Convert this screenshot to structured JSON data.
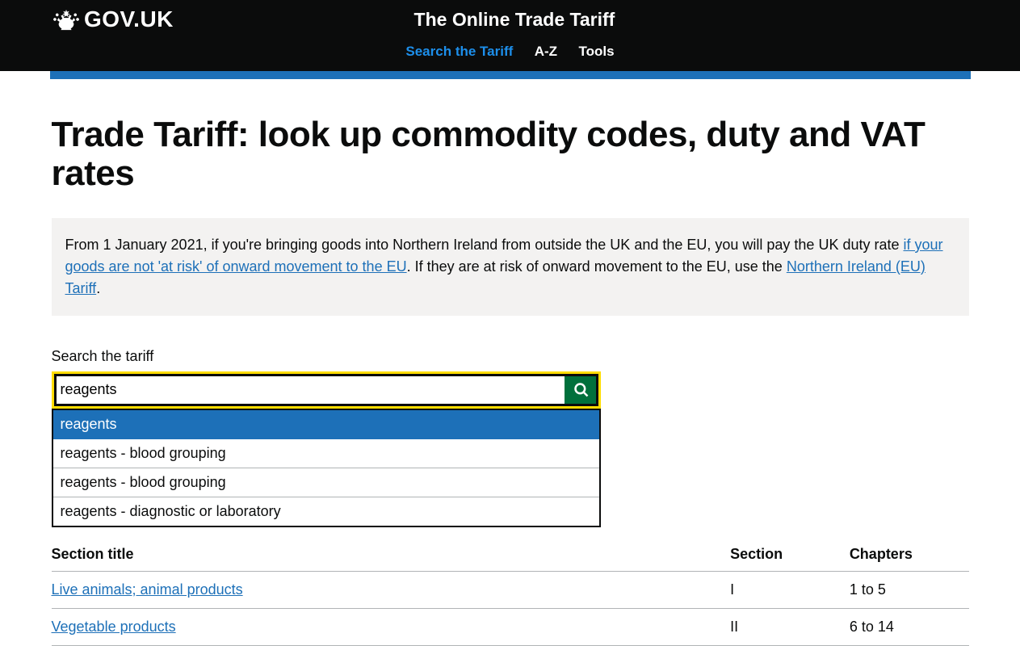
{
  "header": {
    "govuk": "GOV.UK",
    "service_name": "The Online Trade Tariff",
    "nav": {
      "search": "Search the Tariff",
      "az": "A-Z",
      "tools": "Tools"
    }
  },
  "page": {
    "title": "Trade Tariff: look up commodity codes, duty and VAT rates"
  },
  "notice": {
    "text_part1": "From 1 January 2021, if you're bringing goods into Northern Ireland from outside the UK and the EU, you will pay the UK duty rate ",
    "link1": "if your goods are not 'at risk' of onward movement to the EU",
    "text_part2": ". If they are at risk of onward movement to the EU, use the ",
    "link2": "Northern Ireland (EU) Tariff",
    "text_part3": "."
  },
  "search": {
    "label": "Search the tariff",
    "value": "reagents",
    "autocomplete": [
      {
        "label": "reagents",
        "highlighted": true
      },
      {
        "label": "reagents - blood grouping",
        "highlighted": false
      },
      {
        "label": "reagents - blood grouping",
        "highlighted": false
      },
      {
        "label": "reagents - diagnostic or laboratory",
        "highlighted": false
      }
    ]
  },
  "table": {
    "headers": {
      "section_title": "Section title",
      "section": "Section",
      "chapters": "Chapters"
    },
    "rows": [
      {
        "title": "Live animals; animal products",
        "section": "I",
        "chapters": "1 to 5"
      },
      {
        "title": "Vegetable products",
        "section": "II",
        "chapters": "6 to 14"
      }
    ]
  }
}
